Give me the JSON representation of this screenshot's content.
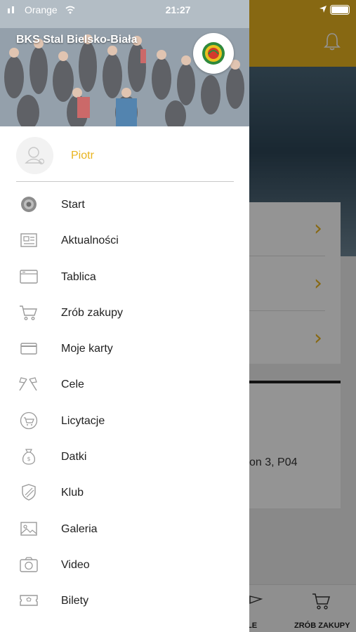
{
  "status_bar": {
    "carrier": "Orange",
    "time": "21:27"
  },
  "drawer": {
    "club_name": "BKS Stal Bielsko-Biała",
    "user_name": "Piotr",
    "items": [
      {
        "label": "Start",
        "icon": "club-crest-icon"
      },
      {
        "label": "Aktualności",
        "icon": "newspaper-icon"
      },
      {
        "label": "Tablica",
        "icon": "board-icon"
      },
      {
        "label": "Zrób zakupy",
        "icon": "shopping-cart-icon"
      },
      {
        "label": "Moje karty",
        "icon": "card-icon"
      },
      {
        "label": "Cele",
        "icon": "flags-icon"
      },
      {
        "label": "Licytacje",
        "icon": "auction-icon"
      },
      {
        "label": "Datki",
        "icon": "money-bag-icon"
      },
      {
        "label": "Klub",
        "icon": "shield-icon"
      },
      {
        "label": "Galeria",
        "icon": "image-icon"
      },
      {
        "label": "Video",
        "icon": "camera-icon"
      },
      {
        "label": "Bilety",
        "icon": "ticket-icon"
      }
    ]
  },
  "background": {
    "card_text": "on 3, P04",
    "tab_cele": "LE",
    "tab_shop": "ZRÓB ZAKUPY"
  },
  "colors": {
    "accent": "#e9b41f",
    "text": "#222222",
    "icon": "#9a9a9a"
  }
}
